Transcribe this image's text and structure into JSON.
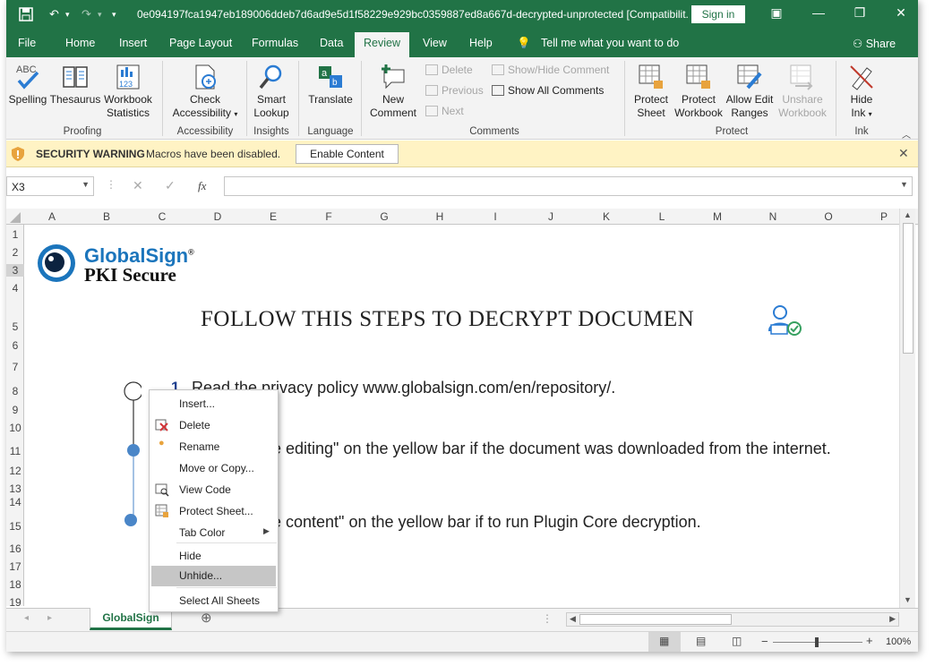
{
  "title_bar": {
    "title": "0e094197fca1947eb189006ddeb7d6ad9e5d1f58229e929bc0359887ed8a667d-decrypted-unprotected  [Compatibilit...",
    "sign_in": "Sign in",
    "undo_icon": "undo-icon",
    "redo_icon": "redo-icon"
  },
  "ribbon_tabs": [
    "File",
    "Home",
    "Insert",
    "Page Layout",
    "Formulas",
    "Data",
    "Review",
    "View",
    "Help"
  ],
  "active_tab": "Review",
  "tell_me": "Tell me what you want to do",
  "share": "Share",
  "ribbon": {
    "proofing": {
      "spelling": "Spelling",
      "thesaurus": "Thesaurus",
      "workbook_stats": [
        "Workbook",
        "Statistics"
      ],
      "group": "Proofing",
      "abc": "ABC",
      "stats_num": "123"
    },
    "accessibility": {
      "check": [
        "Check",
        "Accessibility"
      ],
      "group": "Accessibility"
    },
    "insights": {
      "smart_lookup": [
        "Smart",
        "Lookup"
      ],
      "group": "Insights"
    },
    "language": {
      "translate": "Translate",
      "group": "Language"
    },
    "comments": {
      "new_comment": [
        "New",
        "Comment"
      ],
      "delete": "Delete",
      "previous": "Previous",
      "next": "Next",
      "show_hide": "Show/Hide Comment",
      "show_all": "Show All Comments",
      "group": "Comments"
    },
    "protect": {
      "protect_sheet": [
        "Protect",
        "Sheet"
      ],
      "protect_workbook": [
        "Protect",
        "Workbook"
      ],
      "allow_edit": [
        "Allow Edit",
        "Ranges"
      ],
      "unshare": [
        "Unshare",
        "Workbook"
      ],
      "group": "Protect"
    },
    "ink": {
      "hide_ink": [
        "Hide",
        "Ink"
      ],
      "group": "Ink"
    }
  },
  "security_bar": {
    "label": "SECURITY WARNING",
    "message": "Macros have been disabled.",
    "button": "Enable Content"
  },
  "formula_bar": {
    "name_box": "X3",
    "fx": "fx",
    "formula": ""
  },
  "columns": [
    "A",
    "B",
    "C",
    "D",
    "E",
    "F",
    "G",
    "H",
    "I",
    "J",
    "K",
    "L",
    "M",
    "N",
    "O",
    "P"
  ],
  "rows": [
    "1",
    "2",
    "3",
    "4",
    "5",
    "6",
    "7",
    "8",
    "9",
    "10",
    "11",
    "12",
    "13",
    "14",
    "15",
    "16",
    "17",
    "18",
    "19"
  ],
  "document": {
    "logo_name": "GlobalSign",
    "logo_reg": "®",
    "logo_sub": "PKI Secure",
    "heading": "FOLLOW THIS STEPS TO DECRYPT DOCUMEN",
    "step1_num": "1",
    "step1": "Read the privacy policy www.globalsign.com/en/repository/.",
    "step2": "e editing\" on the yellow bar if the document was downloaded from the internet.",
    "step3": "e content\" on the yellow bar if to run Plugin Core decryption."
  },
  "context_menu": [
    "Insert...",
    "Delete",
    "Rename",
    "Move or Copy...",
    "View Code",
    "Protect Sheet...",
    "Tab Color",
    "Hide",
    "Unhide...",
    "Select All Sheets"
  ],
  "context_menu_highlighted": "Unhide...",
  "sheet_tabs": [
    "GlobalSign"
  ],
  "status_bar": {
    "zoom": "100%",
    "minus": "−",
    "plus": "+"
  },
  "colors": {
    "excel_green": "#217346",
    "security_bar": "#fff3c4",
    "menu_highlight": "#c6c6c6"
  }
}
